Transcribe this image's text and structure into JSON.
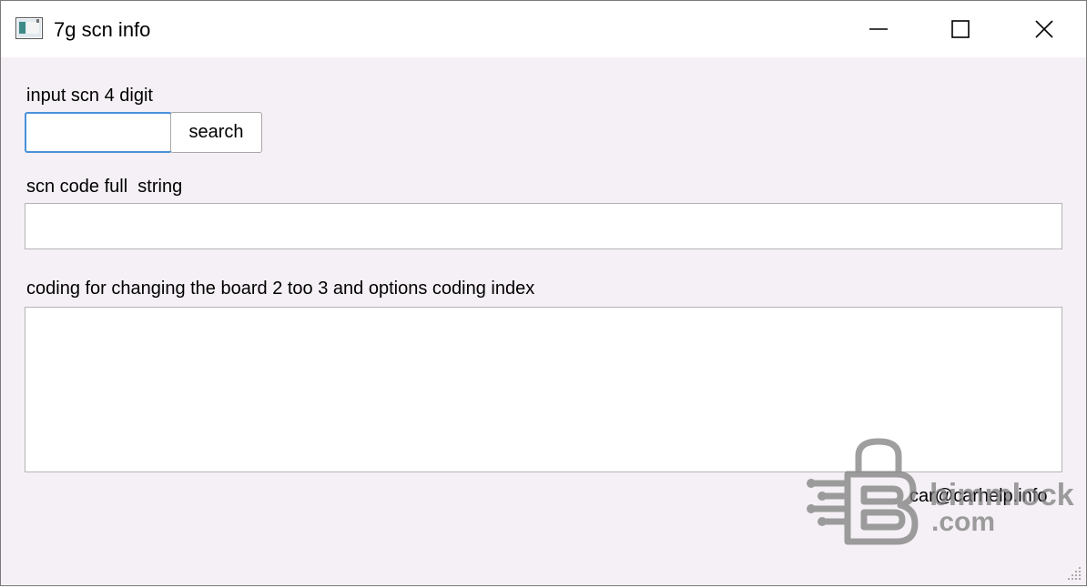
{
  "window": {
    "title": "7g scn info",
    "controls": {
      "minimize": "minimize-icon",
      "maximize": "maximize-icon",
      "close": "close-icon"
    }
  },
  "form": {
    "scn_label": "input scn 4 digit",
    "scn_value": "",
    "search_label": "search",
    "full_string_label": "scn code full  string",
    "full_string_value": "",
    "coding_label": "coding for changing the board 2 too 3 and options coding index",
    "coding_value": ""
  },
  "footer": {
    "email": "car@carhelp.info"
  },
  "watermark": {
    "text_top": "bimmlock",
    "text_bottom": ".com"
  },
  "colors": {
    "client_bg": "#f5f0f5",
    "focus_border": "#4a90d9",
    "watermark": "#7b7b7b"
  }
}
